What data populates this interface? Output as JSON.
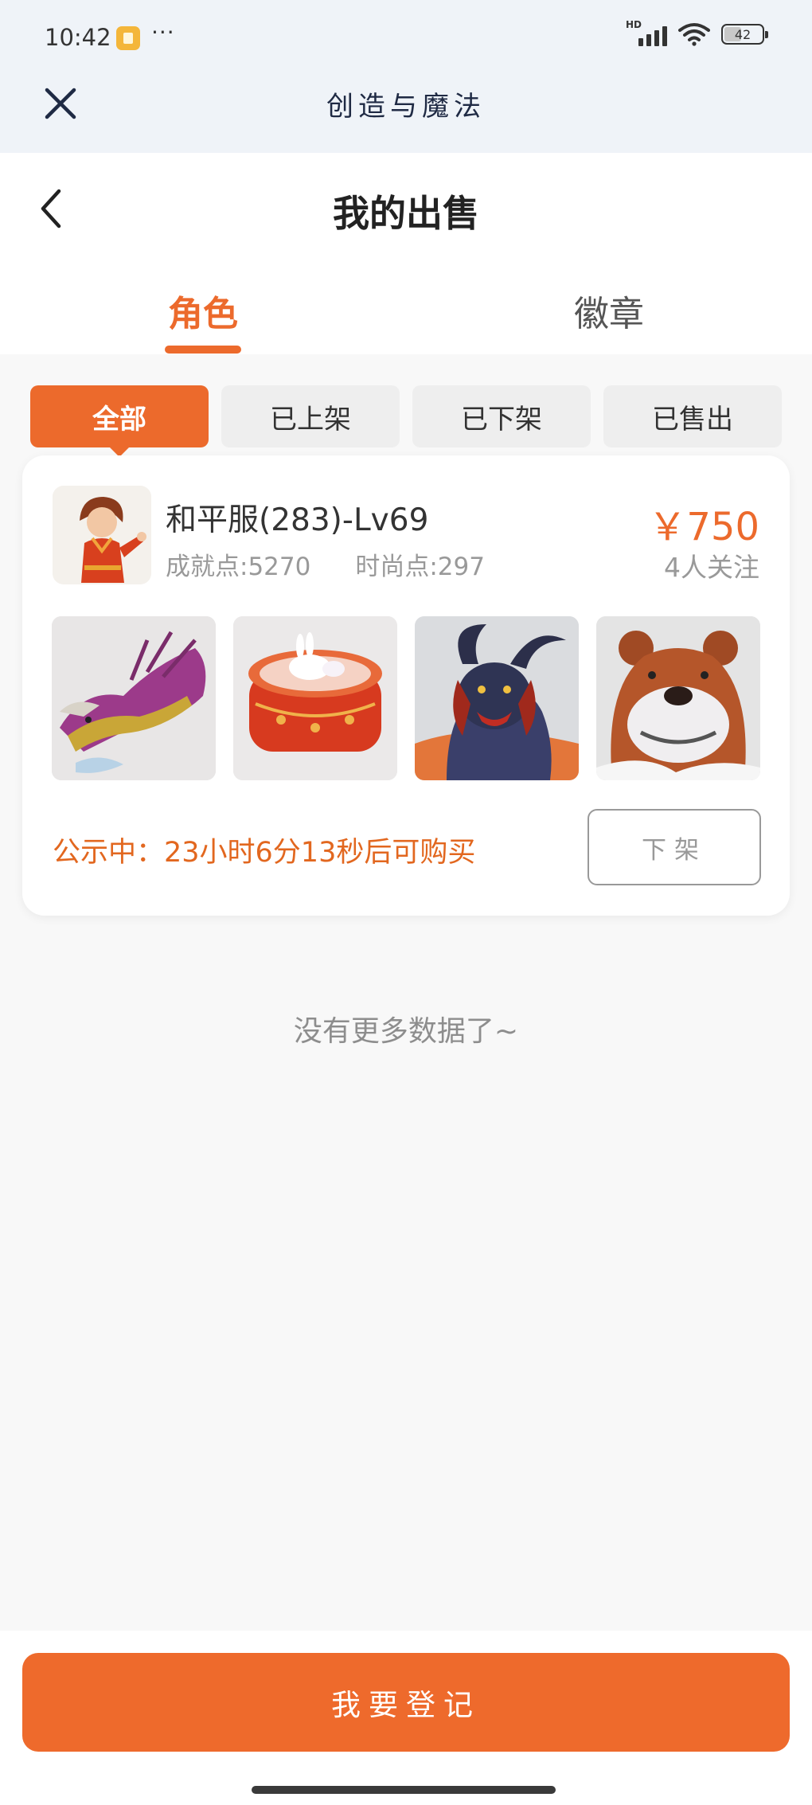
{
  "status_bar": {
    "time": "10:42",
    "more": "···",
    "network": "HD",
    "battery": "42"
  },
  "app_header": {
    "title": "创造与魔法"
  },
  "page": {
    "title": "我的出售"
  },
  "tabs": [
    {
      "label": "角色",
      "active": true
    },
    {
      "label": "徽章",
      "active": false
    }
  ],
  "filters": [
    {
      "label": "全部",
      "active": true
    },
    {
      "label": "已上架",
      "active": false
    },
    {
      "label": "已下架",
      "active": false
    },
    {
      "label": "已售出",
      "active": false
    }
  ],
  "listing": {
    "name": "和平服(283)-Lv69",
    "achievement": "成就点:5270",
    "fashion": "时尚点:297",
    "price": "￥750",
    "followers": "4人关注",
    "thumbnails": [
      "dragon-mount",
      "bunny-drum",
      "horned-beast",
      "bear"
    ],
    "notice": "公示中：23小时6分13秒后可购买",
    "delist_label": "下架"
  },
  "footer_note": "没有更多数据了~",
  "bottom": {
    "register_label": "我要登记"
  },
  "colors": {
    "accent": "#ec6a2c",
    "header_bg": "#eff3f8",
    "page_bg": "#f8f8f8"
  }
}
